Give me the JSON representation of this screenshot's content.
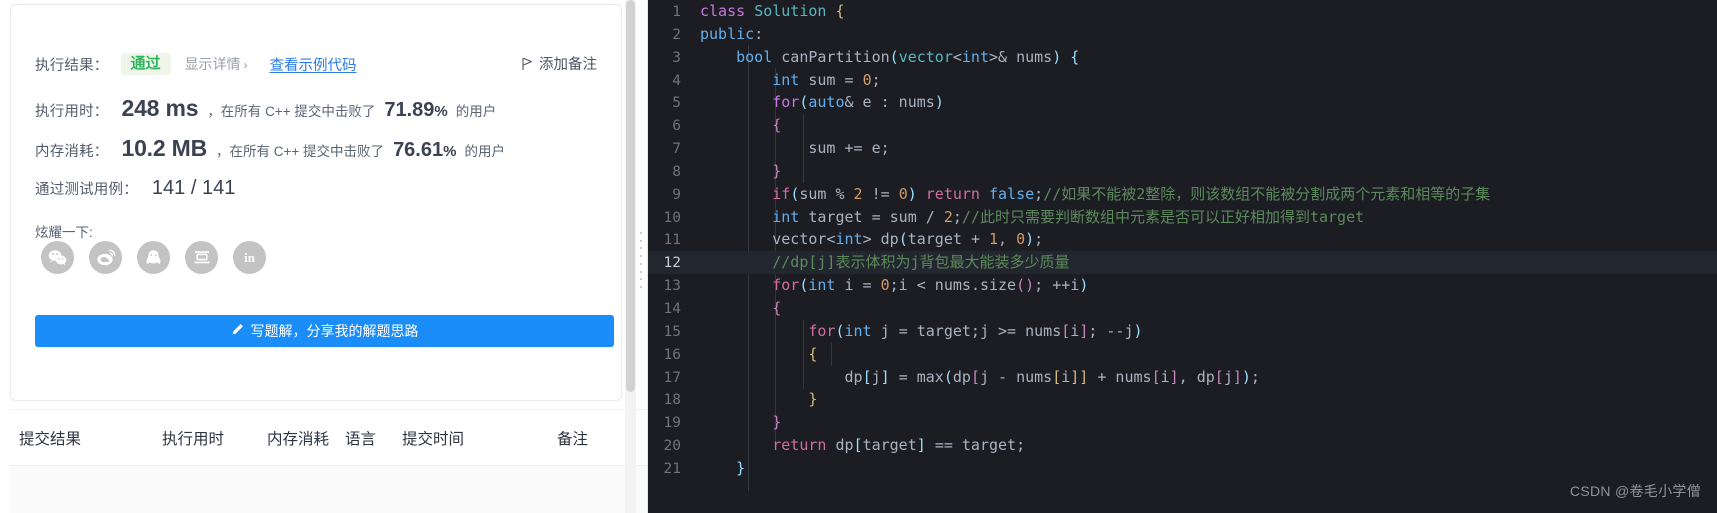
{
  "result_panel": {
    "result_label": "执行结果：",
    "status_badge": "通过",
    "detail_link": "显示详情",
    "detail_chevron": "›",
    "sample_code_link": "查看示例代码",
    "add_note": "添加备注",
    "runtime": {
      "label": "执行用时：",
      "value": "248 ms",
      "middle": "，在所有 C++ 提交中击败了",
      "percent": "71.89",
      "percent_sign": "%",
      "tail": "的用户"
    },
    "memory": {
      "label": "内存消耗：",
      "value": "10.2 MB",
      "middle": "，在所有 C++ 提交中击败了",
      "percent": "76.61",
      "percent_sign": "%",
      "tail": "的用户"
    },
    "testcases": {
      "label": "通过测试用例：",
      "value": "141 / 141"
    },
    "show_off_label": "炫耀一下:",
    "social": [
      {
        "name": "wechat",
        "letter": ""
      },
      {
        "name": "weibo",
        "letter": ""
      },
      {
        "name": "qq",
        "letter": ""
      },
      {
        "name": "douban",
        "letter": "豆"
      },
      {
        "name": "linkedin",
        "letter": "in"
      }
    ],
    "write_solution_button": "写题解，分享我的解题思路"
  },
  "submissions_table": {
    "columns": [
      "提交结果",
      "执行用时",
      "内存消耗",
      "语言",
      "提交时间",
      "备注"
    ]
  },
  "editor": {
    "language": "cpp",
    "active_line": 12,
    "colors": {
      "background": "#1b1d23",
      "active_line": "#22262e",
      "gutter_text": "#6d737d",
      "comment": "#5c8a5c",
      "keyword": "#c678dd",
      "type": "#61afef",
      "number": "#d19a66",
      "identifier": "#abb2bf"
    },
    "lines": [
      {
        "n": 1,
        "tokens": [
          {
            "t": "class",
            "c": "k"
          },
          {
            "t": " ",
            "c": "op"
          },
          {
            "t": "Solution",
            "c": "ty"
          },
          {
            "t": " ",
            "c": "op"
          },
          {
            "t": "{",
            "c": "br1"
          }
        ]
      },
      {
        "n": 2,
        "tokens": [
          {
            "t": "public",
            "c": "kb"
          },
          {
            "t": ":",
            "c": "op"
          }
        ]
      },
      {
        "n": 3,
        "tokens": [
          {
            "t": "    ",
            "c": "op"
          },
          {
            "t": "bool",
            "c": "kb"
          },
          {
            "t": " ",
            "c": "op"
          },
          {
            "t": "canPartition",
            "c": "id"
          },
          {
            "t": "(",
            "c": "br2"
          },
          {
            "t": "vector",
            "c": "ty"
          },
          {
            "t": "<",
            "c": "op"
          },
          {
            "t": "int",
            "c": "kb"
          },
          {
            "t": ">",
            "c": "op"
          },
          {
            "t": "& ",
            "c": "op"
          },
          {
            "t": "nums",
            "c": "id"
          },
          {
            "t": ")",
            "c": "br2"
          },
          {
            "t": " ",
            "c": "op"
          },
          {
            "t": "{",
            "c": "br2"
          }
        ]
      },
      {
        "n": 4,
        "tokens": [
          {
            "t": "        ",
            "c": "op"
          },
          {
            "t": "int",
            "c": "kb"
          },
          {
            "t": " sum ",
            "c": "id"
          },
          {
            "t": "=",
            "c": "op"
          },
          {
            "t": " ",
            "c": "op"
          },
          {
            "t": "0",
            "c": "num"
          },
          {
            "t": ";",
            "c": "op"
          }
        ]
      },
      {
        "n": 5,
        "tokens": [
          {
            "t": "        ",
            "c": "op"
          },
          {
            "t": "for",
            "c": "k"
          },
          {
            "t": "(",
            "c": "br2"
          },
          {
            "t": "auto",
            "c": "kb"
          },
          {
            "t": "& e : nums",
            "c": "id"
          },
          {
            "t": ")",
            "c": "br2"
          }
        ]
      },
      {
        "n": 6,
        "tokens": [
          {
            "t": "        ",
            "c": "op"
          },
          {
            "t": "{",
            "c": "br3"
          }
        ]
      },
      {
        "n": 7,
        "tokens": [
          {
            "t": "            ",
            "c": "op"
          },
          {
            "t": "sum ",
            "c": "id"
          },
          {
            "t": "+=",
            "c": "op"
          },
          {
            "t": " e",
            "c": "id"
          },
          {
            "t": ";",
            "c": "op"
          }
        ]
      },
      {
        "n": 8,
        "tokens": [
          {
            "t": "        ",
            "c": "op"
          },
          {
            "t": "}",
            "c": "br3"
          }
        ]
      },
      {
        "n": 9,
        "tokens": [
          {
            "t": "        ",
            "c": "op"
          },
          {
            "t": "if",
            "c": "pink"
          },
          {
            "t": "(",
            "c": "br2"
          },
          {
            "t": "sum ",
            "c": "id"
          },
          {
            "t": "%",
            "c": "op"
          },
          {
            "t": " ",
            "c": "op"
          },
          {
            "t": "2",
            "c": "num"
          },
          {
            "t": " ",
            "c": "op"
          },
          {
            "t": "!=",
            "c": "op"
          },
          {
            "t": " ",
            "c": "op"
          },
          {
            "t": "0",
            "c": "num"
          },
          {
            "t": ")",
            "c": "br2"
          },
          {
            "t": " ",
            "c": "op"
          },
          {
            "t": "return",
            "c": "pink"
          },
          {
            "t": " ",
            "c": "op"
          },
          {
            "t": "false",
            "c": "kb"
          },
          {
            "t": ";",
            "c": "op"
          },
          {
            "t": "//如果不能被2整除，则该数组不能被分割成两个元素和相等的子集",
            "c": "cm"
          }
        ]
      },
      {
        "n": 10,
        "tokens": [
          {
            "t": "        ",
            "c": "op"
          },
          {
            "t": "int",
            "c": "kb"
          },
          {
            "t": " target ",
            "c": "id"
          },
          {
            "t": "=",
            "c": "op"
          },
          {
            "t": " sum ",
            "c": "id"
          },
          {
            "t": "/",
            "c": "op"
          },
          {
            "t": " ",
            "c": "op"
          },
          {
            "t": "2",
            "c": "num"
          },
          {
            "t": ";",
            "c": "op"
          },
          {
            "t": "//此时只需要判断数组中元素是否可以正好相加得到target",
            "c": "cm"
          }
        ]
      },
      {
        "n": 11,
        "tokens": [
          {
            "t": "        ",
            "c": "op"
          },
          {
            "t": "vector",
            "c": "id"
          },
          {
            "t": "<",
            "c": "op"
          },
          {
            "t": "int",
            "c": "kb"
          },
          {
            "t": ">",
            "c": "op"
          },
          {
            "t": " dp",
            "c": "id"
          },
          {
            "t": "(",
            "c": "br2"
          },
          {
            "t": "target ",
            "c": "id"
          },
          {
            "t": "+",
            "c": "op"
          },
          {
            "t": " ",
            "c": "op"
          },
          {
            "t": "1",
            "c": "num"
          },
          {
            "t": ", ",
            "c": "op"
          },
          {
            "t": "0",
            "c": "num"
          },
          {
            "t": ")",
            "c": "br2"
          },
          {
            "t": ";",
            "c": "op"
          }
        ]
      },
      {
        "n": 12,
        "tokens": [
          {
            "t": "        ",
            "c": "op"
          },
          {
            "t": "//dp[j]表示体积为j背包最大能装多少质量",
            "c": "cm"
          }
        ],
        "active": true
      },
      {
        "n": 13,
        "tokens": [
          {
            "t": "        ",
            "c": "op"
          },
          {
            "t": "for",
            "c": "pink"
          },
          {
            "t": "(",
            "c": "br2"
          },
          {
            "t": "int",
            "c": "kb"
          },
          {
            "t": " i ",
            "c": "id"
          },
          {
            "t": "=",
            "c": "op"
          },
          {
            "t": " ",
            "c": "op"
          },
          {
            "t": "0",
            "c": "num"
          },
          {
            "t": ";i ",
            "c": "id"
          },
          {
            "t": "<",
            "c": "op"
          },
          {
            "t": " nums",
            "c": "id"
          },
          {
            "t": ".",
            "c": "op"
          },
          {
            "t": "size",
            "c": "id"
          },
          {
            "t": "()",
            "c": "br3"
          },
          {
            "t": "; ",
            "c": "op"
          },
          {
            "t": "++",
            "c": "op"
          },
          {
            "t": "i",
            "c": "id"
          },
          {
            "t": ")",
            "c": "br2"
          }
        ]
      },
      {
        "n": 14,
        "tokens": [
          {
            "t": "        ",
            "c": "op"
          },
          {
            "t": "{",
            "c": "br3"
          }
        ]
      },
      {
        "n": 15,
        "tokens": [
          {
            "t": "            ",
            "c": "op"
          },
          {
            "t": "for",
            "c": "pink"
          },
          {
            "t": "(",
            "c": "br2"
          },
          {
            "t": "int",
            "c": "kb"
          },
          {
            "t": " j ",
            "c": "id"
          },
          {
            "t": "=",
            "c": "op"
          },
          {
            "t": " target;j ",
            "c": "id"
          },
          {
            "t": ">=",
            "c": "op"
          },
          {
            "t": " nums",
            "c": "id"
          },
          {
            "t": "[",
            "c": "br3"
          },
          {
            "t": "i",
            "c": "id"
          },
          {
            "t": "]",
            "c": "br3"
          },
          {
            "t": "; ",
            "c": "op"
          },
          {
            "t": "--",
            "c": "op"
          },
          {
            "t": "j",
            "c": "id"
          },
          {
            "t": ")",
            "c": "br2"
          }
        ]
      },
      {
        "n": 16,
        "tokens": [
          {
            "t": "            ",
            "c": "op"
          },
          {
            "t": "{",
            "c": "br1"
          }
        ]
      },
      {
        "n": 17,
        "tokens": [
          {
            "t": "                ",
            "c": "op"
          },
          {
            "t": "dp",
            "c": "id"
          },
          {
            "t": "[",
            "c": "br2"
          },
          {
            "t": "j",
            "c": "id"
          },
          {
            "t": "]",
            "c": "br2"
          },
          {
            "t": " ",
            "c": "op"
          },
          {
            "t": "=",
            "c": "op"
          },
          {
            "t": " ",
            "c": "op"
          },
          {
            "t": "max",
            "c": "id"
          },
          {
            "t": "(",
            "c": "br2"
          },
          {
            "t": "dp",
            "c": "id"
          },
          {
            "t": "[",
            "c": "br3"
          },
          {
            "t": "j ",
            "c": "id"
          },
          {
            "t": "-",
            "c": "op"
          },
          {
            "t": " nums",
            "c": "id"
          },
          {
            "t": "[",
            "c": "br1"
          },
          {
            "t": "i",
            "c": "id"
          },
          {
            "t": "]]",
            "c": "br1"
          },
          {
            "t": " ",
            "c": "op"
          },
          {
            "t": "+",
            "c": "op"
          },
          {
            "t": " nums",
            "c": "id"
          },
          {
            "t": "[",
            "c": "br3"
          },
          {
            "t": "i",
            "c": "id"
          },
          {
            "t": "]",
            "c": "br3"
          },
          {
            "t": ", ",
            "c": "op"
          },
          {
            "t": "dp",
            "c": "id"
          },
          {
            "t": "[",
            "c": "br3"
          },
          {
            "t": "j",
            "c": "id"
          },
          {
            "t": "]",
            "c": "br3"
          },
          {
            "t": ")",
            "c": "br2"
          },
          {
            "t": ";",
            "c": "op"
          }
        ]
      },
      {
        "n": 18,
        "tokens": [
          {
            "t": "            ",
            "c": "op"
          },
          {
            "t": "}",
            "c": "br1"
          }
        ]
      },
      {
        "n": 19,
        "tokens": [
          {
            "t": "        ",
            "c": "op"
          },
          {
            "t": "}",
            "c": "br3"
          }
        ]
      },
      {
        "n": 20,
        "tokens": [
          {
            "t": "        ",
            "c": "op"
          },
          {
            "t": "return",
            "c": "pink"
          },
          {
            "t": " dp",
            "c": "id"
          },
          {
            "t": "[",
            "c": "br2"
          },
          {
            "t": "target",
            "c": "id"
          },
          {
            "t": "]",
            "c": "br2"
          },
          {
            "t": " ",
            "c": "op"
          },
          {
            "t": "==",
            "c": "op"
          },
          {
            "t": " target",
            "c": "id"
          },
          {
            "t": ";",
            "c": "op"
          }
        ]
      },
      {
        "n": 21,
        "tokens": [
          {
            "t": "    ",
            "c": "op"
          },
          {
            "t": "}",
            "c": "br2"
          }
        ]
      }
    ]
  },
  "watermark": "CSDN @卷毛小学僧"
}
